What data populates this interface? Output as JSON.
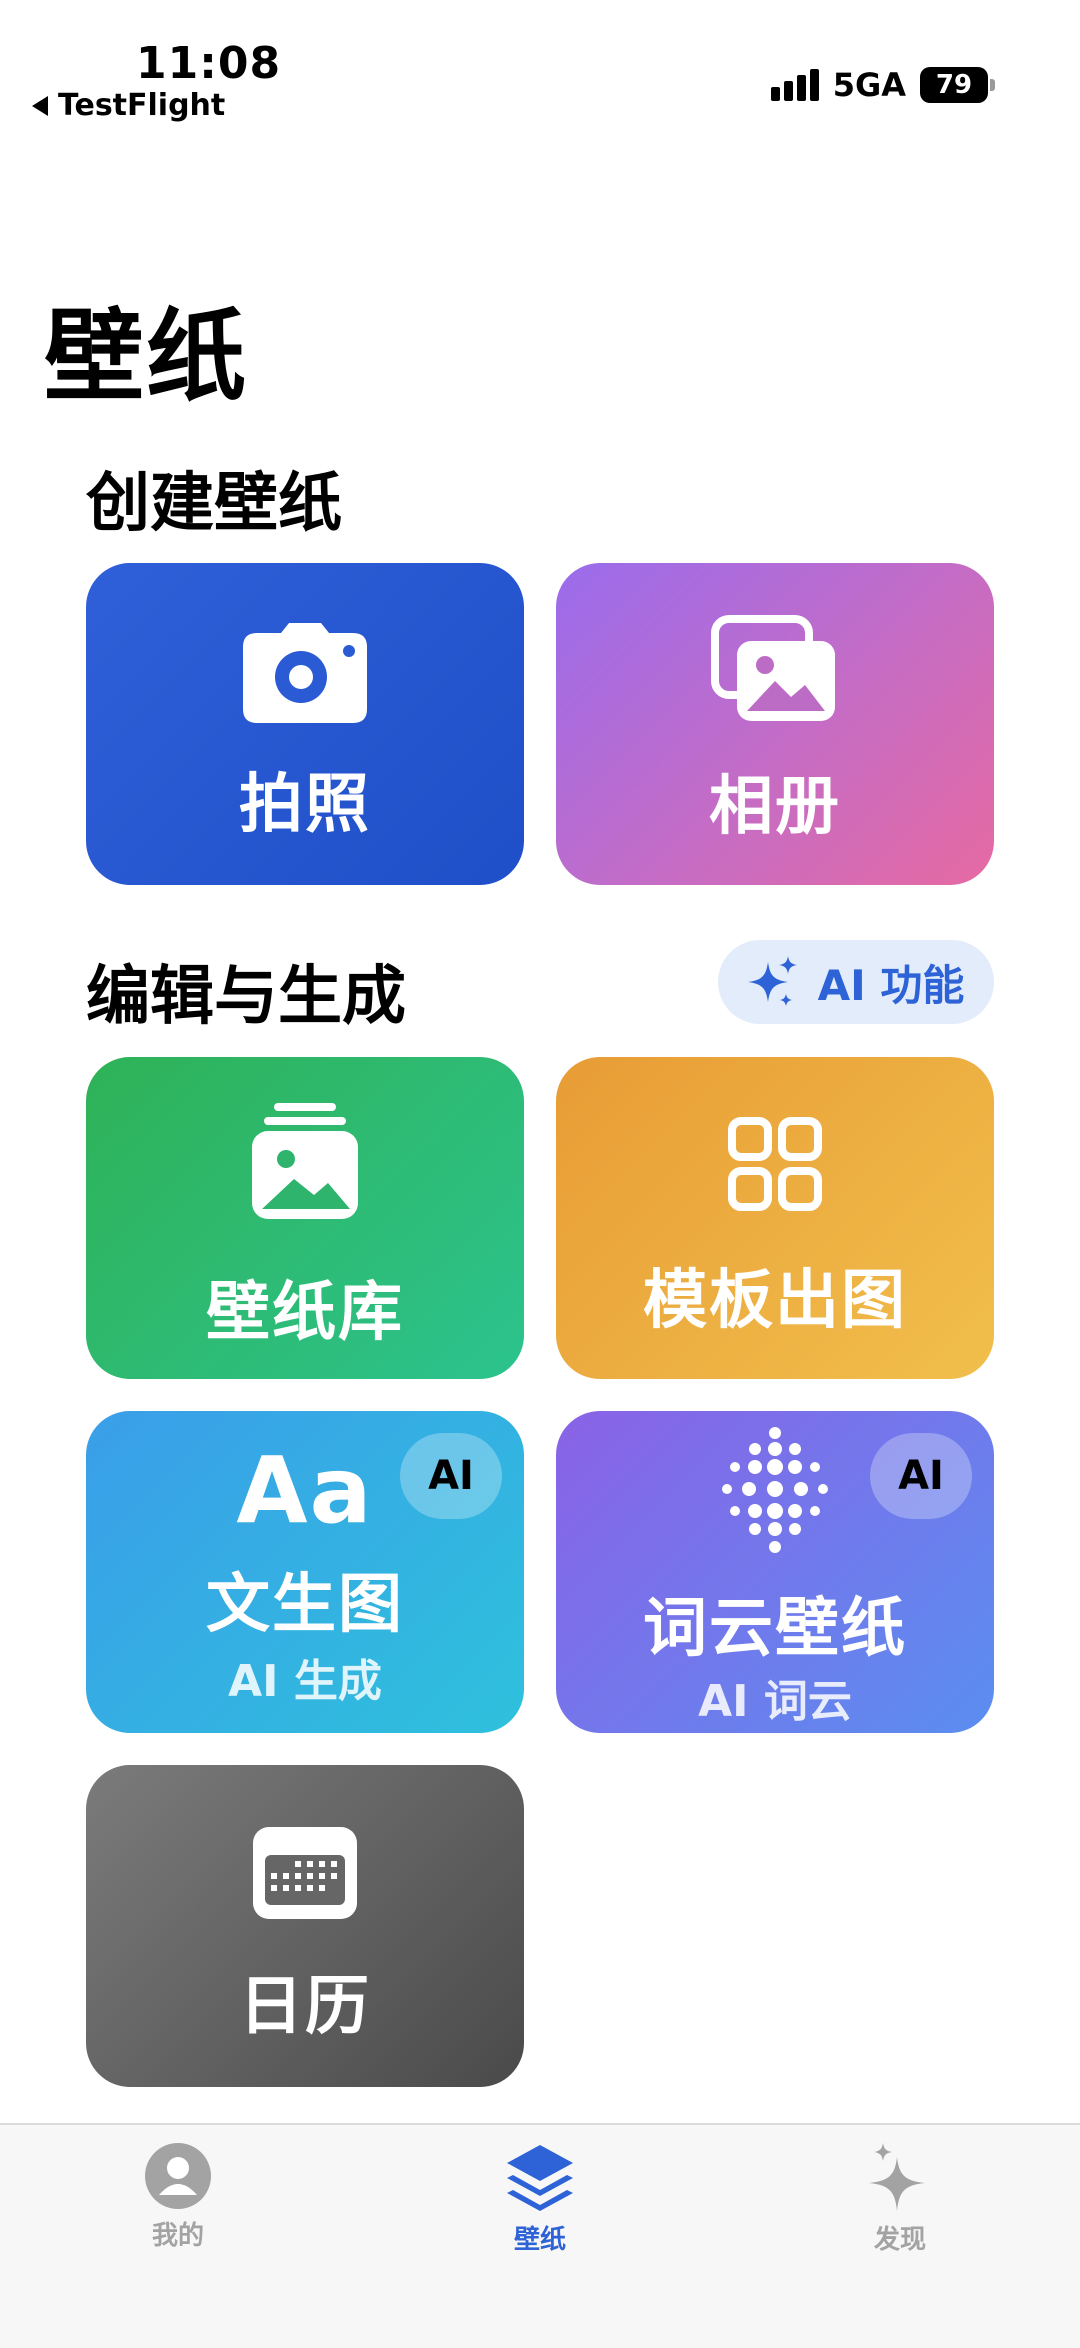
{
  "status_bar": {
    "time": "11:08",
    "back_label": "TestFlight",
    "network": "5GA",
    "battery": "79"
  },
  "page": {
    "title": "壁纸"
  },
  "section_create": {
    "title": "创建壁纸"
  },
  "section_edit": {
    "title": "编辑与生成",
    "badge_label": "AI 功能"
  },
  "cards": {
    "photo": {
      "label": "拍照",
      "icon": "camera-icon"
    },
    "album": {
      "label": "相册",
      "icon": "photos-icon"
    },
    "library": {
      "label": "壁纸库",
      "icon": "photo-stack-icon"
    },
    "template": {
      "label": "模板出图",
      "icon": "grid-icon"
    },
    "text2img": {
      "label": "文生图",
      "sub": "AI 生成",
      "icon_text": "Aa",
      "ai_tag": "AI"
    },
    "wordcloud": {
      "label": "词云壁纸",
      "sub": "AI 词云",
      "icon": "dot-cloud-icon",
      "ai_tag": "AI"
    },
    "calendar": {
      "label": "日历",
      "icon": "calendar-icon"
    }
  },
  "tabbar": {
    "me": {
      "label": "我的",
      "icon": "person-icon"
    },
    "wallpaper": {
      "label": "壁纸",
      "icon": "layers-icon",
      "active": true
    },
    "discover": {
      "label": "发现",
      "icon": "sparkles-icon"
    }
  },
  "colors": {
    "accent": "#2d63d6",
    "inactive": "#a3a3a3"
  }
}
